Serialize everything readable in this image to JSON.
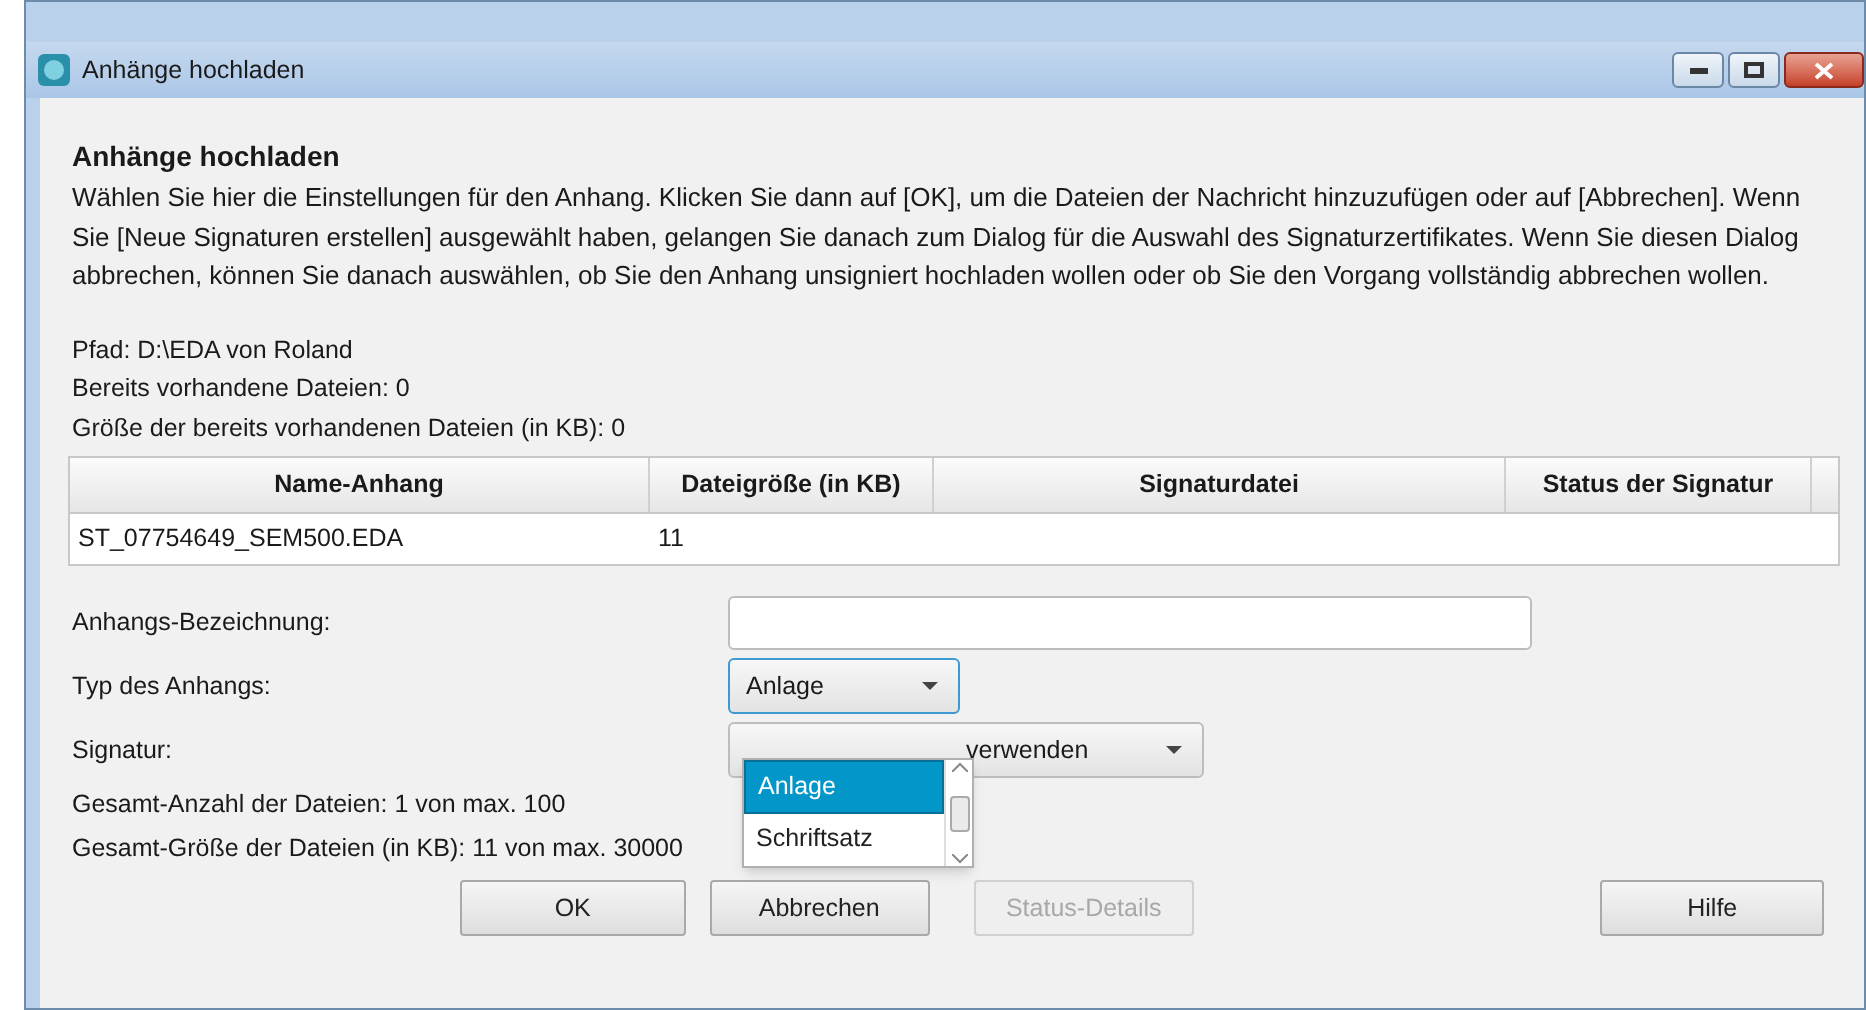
{
  "window": {
    "title": "Anhänge hochladen"
  },
  "heading": "Anhänge hochladen",
  "description": "Wählen Sie hier die Einstellungen für den Anhang. Klicken Sie dann auf [OK], um die Dateien der Nachricht hinzuzufügen oder auf [Abbrechen]. Wenn Sie [Neue Signaturen erstellen] ausgewählt haben, gelangen Sie danach zum Dialog für die Auswahl des Signaturzertifikates. Wenn Sie diesen Dialog abbrechen, können Sie danach auswählen, ob Sie den Anhang unsigniert hochladen wollen oder ob Sie den Vorgang vollständig abbrechen wollen.",
  "info": [
    "Pfad: D:\\EDA von Roland",
    "Bereits vorhandene Dateien: 0",
    "Größe der bereits vorhandenen Dateien (in KB): 0"
  ],
  "table": {
    "columns": [
      "Name-Anhang",
      "Dateigröße (in KB)",
      "Signaturdatei",
      "Status der Signatur"
    ],
    "rows": [
      [
        "ST_07754649_SEM500.EDA",
        "11"
      ]
    ]
  },
  "form": {
    "name_label": "Anhangs-Bezeichnung:",
    "type_label": "Typ des Anhangs:",
    "type_value": "Anlage",
    "signature_label": "Signatur:",
    "signature_value": "verwenden",
    "type_options": [
      {
        "label": "Anlage",
        "selected": true
      },
      {
        "label": "Schriftsatz",
        "selected": false
      }
    ]
  },
  "totals": [
    "Gesamt-Anzahl der Dateien: 1 von max. 100",
    "Gesamt-Größe der Dateien (in KB): 11 von max. 30000"
  ],
  "buttons": [
    {
      "label": "OK",
      "disabled": false
    },
    {
      "label": "Abbrechen",
      "disabled": false
    },
    {
      "label": "Status-Details",
      "disabled": true
    },
    {
      "label": "Hilfe",
      "disabled": false
    }
  ]
}
